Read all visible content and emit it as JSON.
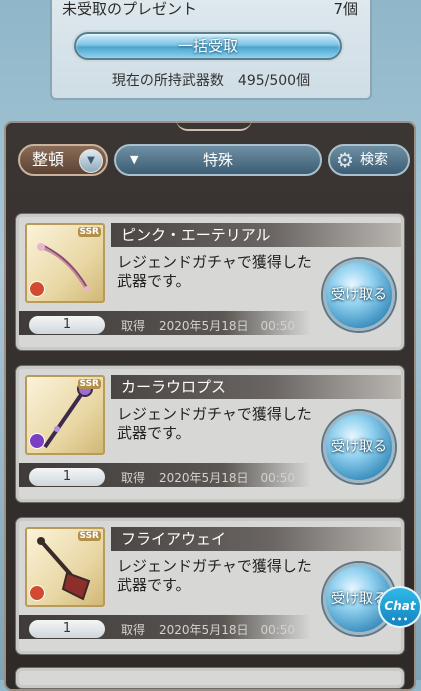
{
  "present_panel": {
    "unclaimed_label": "未受取のプレゼント",
    "unclaimed_count": "7個",
    "bulk_receive_label": "一括受取",
    "weapon_count_text": "現在の所持武器数　495/500個"
  },
  "toolbar": {
    "sort_label": "整頓",
    "filter_value": "特殊",
    "search_label": "検索"
  },
  "cards": [
    {
      "name": "ピンク・エーテリアル",
      "description": "レジェンドガチャで獲得した武器です。",
      "rarity": "SSR",
      "element_color": "#d24a2f",
      "quantity": "1",
      "acquired_label": "取得",
      "acquired_date": "2020年5月18日　00:50",
      "receive_label": "受け取る"
    },
    {
      "name": "カーラウロプス",
      "description": "レジェンドガチャで獲得した武器です。",
      "rarity": "SSR",
      "element_color": "#7a3fc2",
      "quantity": "1",
      "acquired_label": "取得",
      "acquired_date": "2020年5月18日　00:50",
      "receive_label": "受け取る"
    },
    {
      "name": "フライアウェイ",
      "description": "レジェンドガチャで獲得した武器です。",
      "rarity": "SSR",
      "element_color": "#d24a2f",
      "quantity": "1",
      "acquired_label": "取得",
      "acquired_date": "2020年5月18日　00:50",
      "receive_label": "受け取る"
    }
  ],
  "chat": {
    "label": "Chat",
    "dots": "•••"
  }
}
